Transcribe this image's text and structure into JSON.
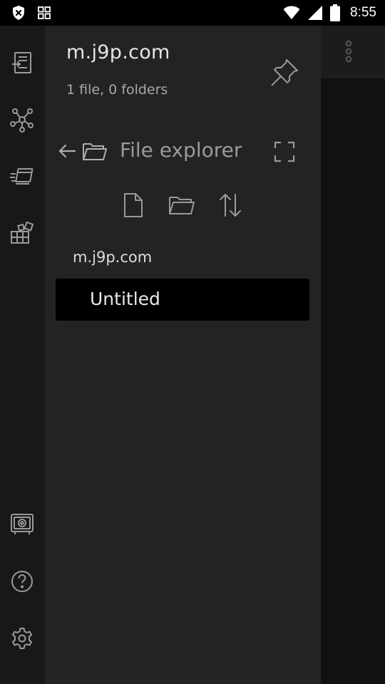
{
  "status_bar": {
    "time": "8:55",
    "left_icons": [
      "shield-x-icon",
      "apps-grid-icon"
    ],
    "right_icons": [
      "wifi-icon",
      "signal-icon",
      "battery-icon"
    ]
  },
  "rail": {
    "icons": [
      "open-quick-switcher-icon",
      "graph-view-icon",
      "open-random-note-icon",
      "plugins-icon",
      "vault-switch-icon",
      "help-icon",
      "settings-icon"
    ]
  },
  "drawer": {
    "vault_name": "m.j9p.com",
    "vault_stats": "1 file, 0 folders",
    "file_explorer": {
      "title": "File explorer",
      "actions": [
        "new-note-icon",
        "new-folder-icon",
        "sort-icon"
      ],
      "root_label": "m.j9p.com",
      "files": [
        {
          "name": "Untitled"
        }
      ]
    }
  },
  "colors": {
    "background": "#111111",
    "rail": "#181818",
    "drawer": "#232323",
    "selected_item": "#000000",
    "icon": "#9a9a9a"
  }
}
